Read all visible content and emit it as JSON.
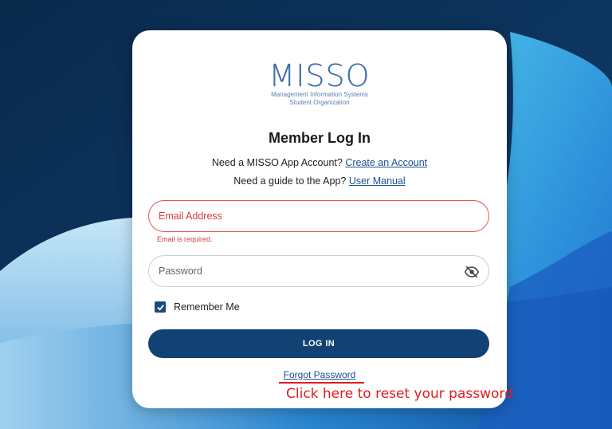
{
  "logo": {
    "name": "MISSO",
    "subtitle_line1": "Management Information Systems",
    "subtitle_line2": "Student Organization"
  },
  "title": "Member Log In",
  "account_prompt": {
    "text": "Need a MISSO App Account?",
    "link": "Create an Account"
  },
  "guide_prompt": {
    "text": "Need a guide to the App?",
    "link": "User Manual"
  },
  "email": {
    "placeholder": "Email Address",
    "value": "",
    "error": "Email is required."
  },
  "password": {
    "placeholder": "Password",
    "value": ""
  },
  "remember": {
    "label": "Remember Me",
    "checked": true
  },
  "login_button": "LOG IN",
  "forgot_link": "Forgot Password",
  "annotation": "Click here to reset your password",
  "colors": {
    "primary": "#114273",
    "link": "#1d4f91",
    "error": "#d83b3b",
    "annotation": "#e21b1b"
  },
  "icons": {
    "password_toggle": "eye-off-icon",
    "checkbox": "check-icon"
  }
}
